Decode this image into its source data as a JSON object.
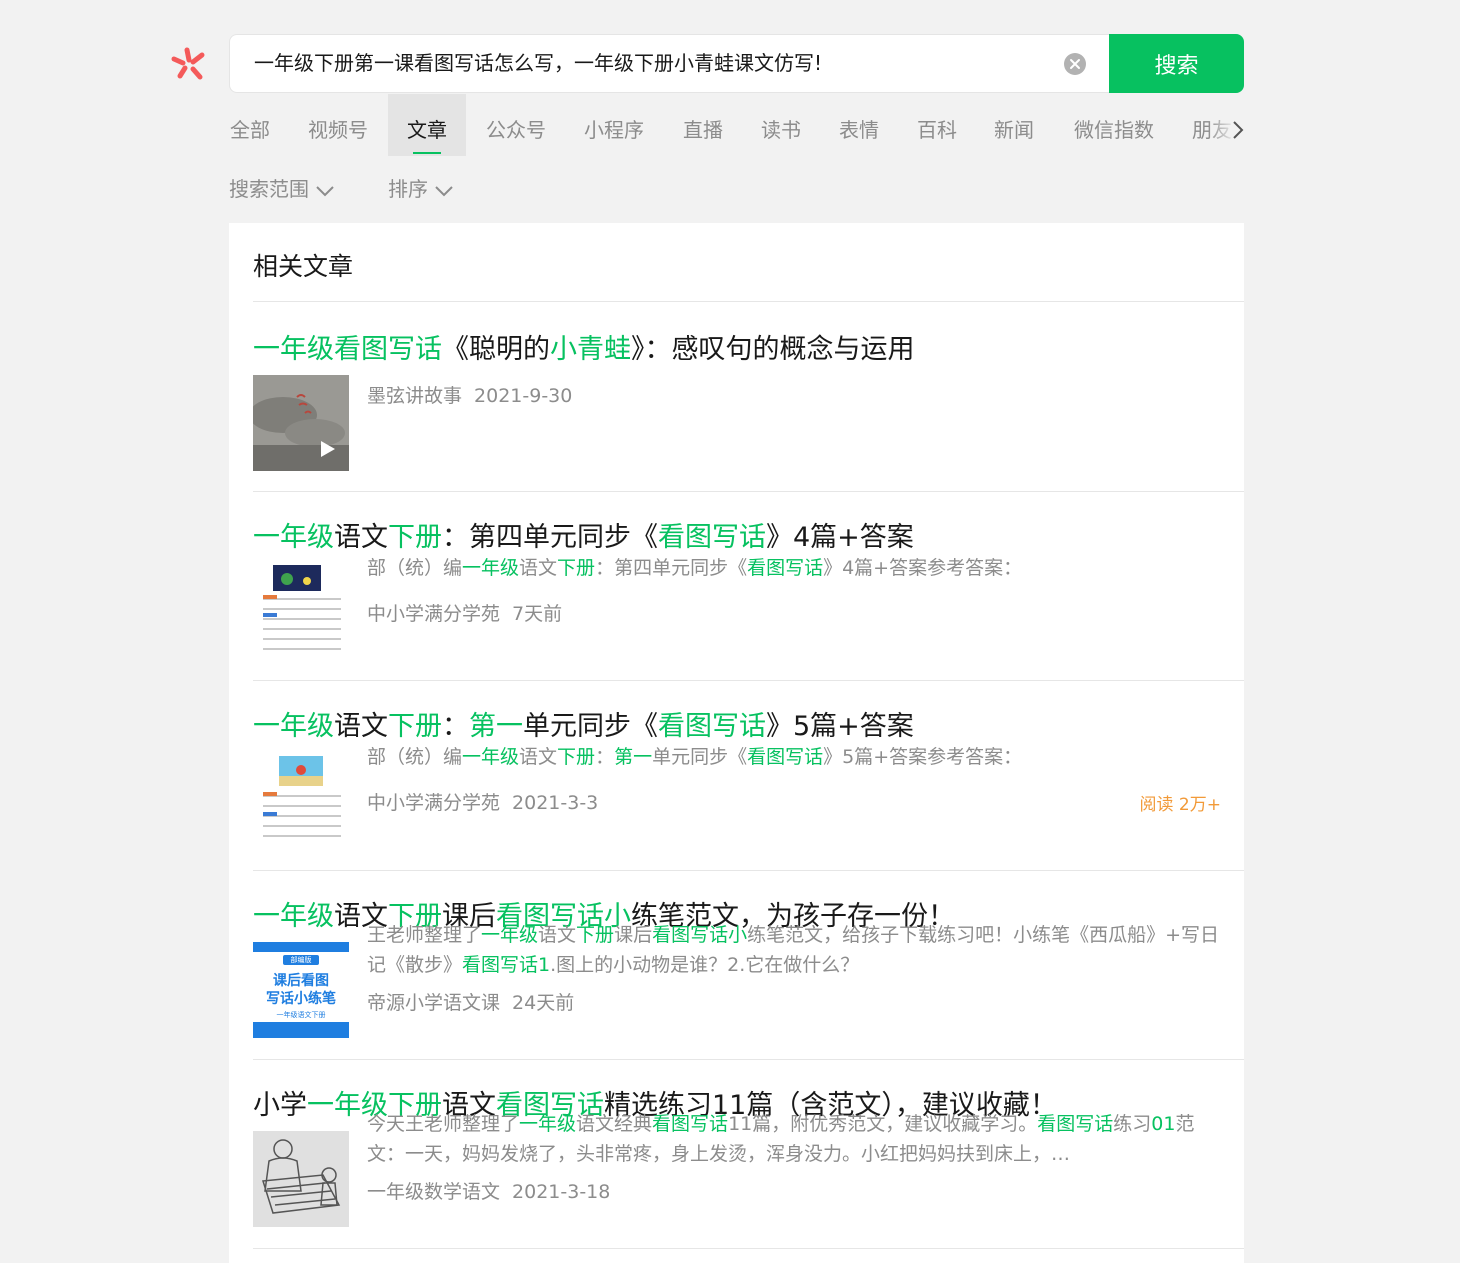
{
  "search": {
    "query": "一年级下册第一课看图写话怎么写，一年级下册小青蛙课文仿写!",
    "button_label": "搜索"
  },
  "tabs": [
    {
      "label": "全部"
    },
    {
      "label": "视频号"
    },
    {
      "label": "文章",
      "active": true
    },
    {
      "label": "公众号"
    },
    {
      "label": "小程序"
    },
    {
      "label": "直播"
    },
    {
      "label": "读书"
    },
    {
      "label": "表情"
    },
    {
      "label": "百科"
    },
    {
      "label": "新闻"
    },
    {
      "label": "微信指数"
    },
    {
      "label": "朋友圈"
    }
  ],
  "filters": {
    "scope_label": "搜索范围",
    "sort_label": "排序"
  },
  "section": {
    "title": "相关文章"
  },
  "articles": [
    {
      "title_parts": [
        {
          "text": "一年级看图写话",
          "hl": true
        },
        {
          "text": "《聪明的",
          "hl": false
        },
        {
          "text": "小青蛙",
          "hl": true
        },
        {
          "text": "》：感叹句的概念与运用",
          "hl": false
        }
      ],
      "thumbnail": "video-thumbnail",
      "snippet_parts": [],
      "source": "墨弦讲故事",
      "date": "2021-9-30",
      "reads": ""
    },
    {
      "title_parts": [
        {
          "text": "一年级",
          "hl": true
        },
        {
          "text": "语文",
          "hl": false
        },
        {
          "text": "下册",
          "hl": true
        },
        {
          "text": "：第四单元同步《",
          "hl": false
        },
        {
          "text": "看图写话",
          "hl": true
        },
        {
          "text": "》4篇+答案",
          "hl": false
        }
      ],
      "thumbnail": "worksheet-thumbnail",
      "snippet_parts": [
        {
          "text": "部（统）编",
          "hl": false
        },
        {
          "text": "一年级",
          "hl": true
        },
        {
          "text": "语文",
          "hl": false
        },
        {
          "text": "下册",
          "hl": true
        },
        {
          "text": "：第四单元同步《",
          "hl": false
        },
        {
          "text": "看图写话",
          "hl": true
        },
        {
          "text": "》4篇+答案参考答案：",
          "hl": false
        }
      ],
      "source": "中小学满分学苑",
      "date": "7天前",
      "reads": ""
    },
    {
      "title_parts": [
        {
          "text": "一年级",
          "hl": true
        },
        {
          "text": "语文",
          "hl": false
        },
        {
          "text": "下册",
          "hl": true
        },
        {
          "text": "：",
          "hl": false
        },
        {
          "text": "第一",
          "hl": true
        },
        {
          "text": "单元同步《",
          "hl": false
        },
        {
          "text": "看图写话",
          "hl": true
        },
        {
          "text": "》5篇+答案",
          "hl": false
        }
      ],
      "thumbnail": "worksheet-thumbnail",
      "snippet_parts": [
        {
          "text": "部（统）编",
          "hl": false
        },
        {
          "text": "一年级",
          "hl": true
        },
        {
          "text": "语文",
          "hl": false
        },
        {
          "text": "下册",
          "hl": true
        },
        {
          "text": "：",
          "hl": false
        },
        {
          "text": "第一",
          "hl": true
        },
        {
          "text": "单元同步《",
          "hl": false
        },
        {
          "text": "看图写话",
          "hl": true
        },
        {
          "text": "》5篇+答案参考答案：",
          "hl": false
        }
      ],
      "source": "中小学满分学苑",
      "date": "2021-3-3",
      "reads": "阅读 2万+"
    },
    {
      "title_parts": [
        {
          "text": "一年级",
          "hl": true
        },
        {
          "text": "语文",
          "hl": false
        },
        {
          "text": "下册",
          "hl": true
        },
        {
          "text": "课后",
          "hl": false
        },
        {
          "text": "看图写话小",
          "hl": true
        },
        {
          "text": "练笔范文，为孩子存一份！",
          "hl": false
        }
      ],
      "thumbnail": "cover-thumbnail",
      "thumbnail_text": {
        "badge": "部编版",
        "line1": "课后看图",
        "line2": "写话小练笔",
        "footer": "一年级语文下册"
      },
      "snippet_parts": [
        {
          "text": "王老师整理了",
          "hl": false
        },
        {
          "text": "一年级",
          "hl": true
        },
        {
          "text": "语文",
          "hl": false
        },
        {
          "text": "下册",
          "hl": true
        },
        {
          "text": "课后",
          "hl": false
        },
        {
          "text": "看图写话小",
          "hl": true
        },
        {
          "text": "练笔范文，给孩子下载练习吧！小练笔《西瓜船》+写日记《散步》",
          "hl": false
        },
        {
          "text": "看图写话1",
          "hl": true
        },
        {
          "text": ".图上的小动物是谁？2.它在做什么？",
          "hl": false
        }
      ],
      "source": "帝源小学语文课",
      "date": "24天前",
      "reads": ""
    },
    {
      "title_parts": [
        {
          "text": "小学",
          "hl": false
        },
        {
          "text": "一年级下册",
          "hl": true
        },
        {
          "text": "语文",
          "hl": false
        },
        {
          "text": "看图写话",
          "hl": true
        },
        {
          "text": "精选练习11篇（含范文），建议收藏！",
          "hl": false
        }
      ],
      "thumbnail": "sketch-thumbnail",
      "snippet_parts": [
        {
          "text": "今天王老师整理了",
          "hl": false
        },
        {
          "text": "一年级",
          "hl": true
        },
        {
          "text": "语文经典",
          "hl": false
        },
        {
          "text": "看图写话",
          "hl": true
        },
        {
          "text": "11篇，附优秀范文，建议收藏学习。",
          "hl": false
        },
        {
          "text": "看图写话",
          "hl": true
        },
        {
          "text": "练习",
          "hl": false
        },
        {
          "text": "01",
          "hl": true
        },
        {
          "text": "范文：一天，妈妈发烧了，头非常疼，身上发烫，浑身没力。小红把妈妈扶到床上，…",
          "hl": false
        }
      ],
      "source": "一年级数学语文",
      "date": "2021-3-18",
      "reads": ""
    }
  ],
  "colors": {
    "accent": "#07c160",
    "text": "#191919",
    "muted": "#8c8c8c",
    "reads": "#f29a38",
    "background": "#f2f2f2"
  }
}
